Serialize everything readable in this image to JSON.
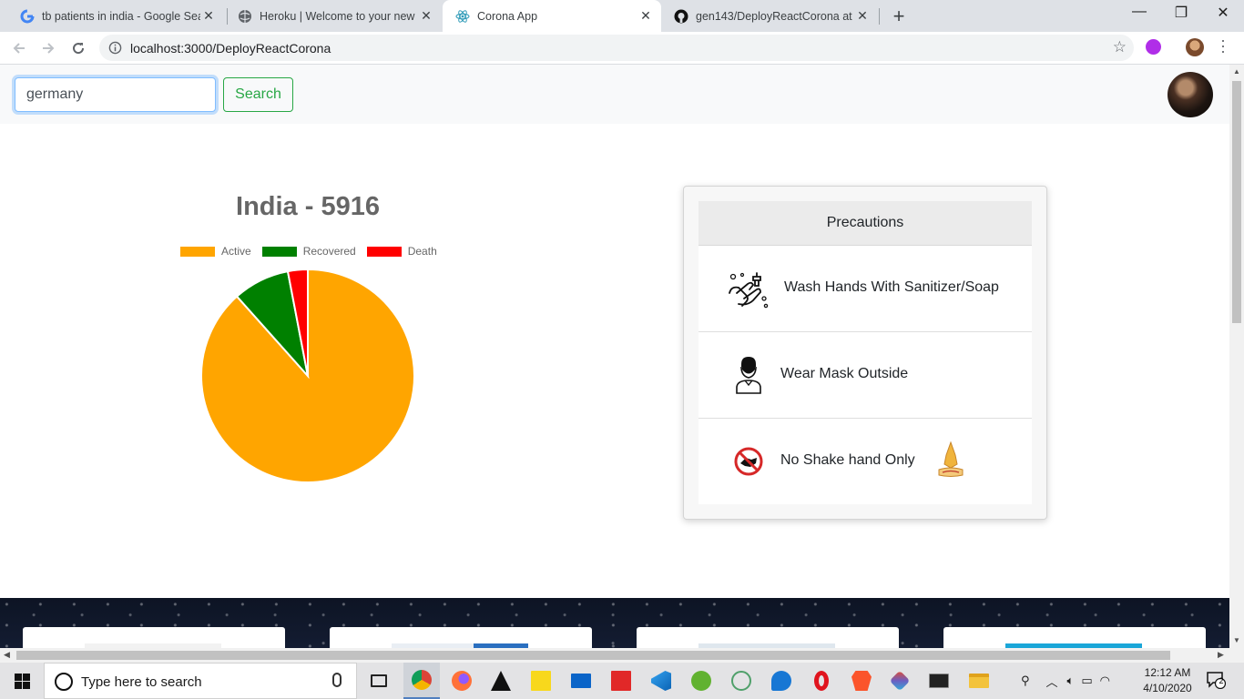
{
  "browser": {
    "tabs": [
      {
        "title": "tb patients in india - Google Sear",
        "favicon": "google-icon",
        "active": false
      },
      {
        "title": "Heroku | Welcome to your new a",
        "favicon": "globe-icon",
        "active": false
      },
      {
        "title": "Corona App",
        "favicon": "react-icon",
        "active": true
      },
      {
        "title": "gen143/DeployReactCorona at m",
        "favicon": "github-icon",
        "active": false
      }
    ],
    "close_glyph": "✕",
    "new_tab_glyph": "+",
    "window_controls": {
      "minimize": "—",
      "maximize": "❐",
      "close": "✕"
    },
    "url": "localhost:3000/DeployReactCorona",
    "star_glyph": "☆"
  },
  "page": {
    "search": {
      "value": "germany",
      "button_label": "Search"
    },
    "chart_title": "India - 5916",
    "precautions": {
      "header": "Precautions",
      "items": [
        {
          "label": "Wash Hands With Sanitizer/Soap",
          "icon": "hand-wash-icon"
        },
        {
          "label": "Wear Mask Outside",
          "icon": "mask-person-icon"
        },
        {
          "label": "No Shake hand Only",
          "icon": "no-handshake-icon",
          "extra_icon": "namaste-icon"
        }
      ]
    }
  },
  "chart_data": {
    "type": "pie",
    "title": "India - 5916",
    "categories": [
      "Active",
      "Recovered",
      "Death"
    ],
    "values": [
      5218,
      506,
      178
    ],
    "colors": [
      "#ffa500",
      "#008000",
      "#ff0000"
    ],
    "legend_position": "top"
  },
  "taskbar": {
    "search_placeholder": "Type here to search",
    "apps": [
      "task-view-icon",
      "chrome-icon",
      "firefox-icon",
      "inkscape-icon",
      "sticky-notes-icon",
      "mail-icon",
      "flipboard-icon",
      "vscode-icon",
      "app-green-icon",
      "atom-icon",
      "edge-icon",
      "opera-icon",
      "brave-icon",
      "git-icon",
      "terminal-icon",
      "file-explorer-icon"
    ],
    "time": "12:12 AM",
    "date": "4/10/2020",
    "notification_count": "2",
    "accent": "#4f7fbf"
  }
}
